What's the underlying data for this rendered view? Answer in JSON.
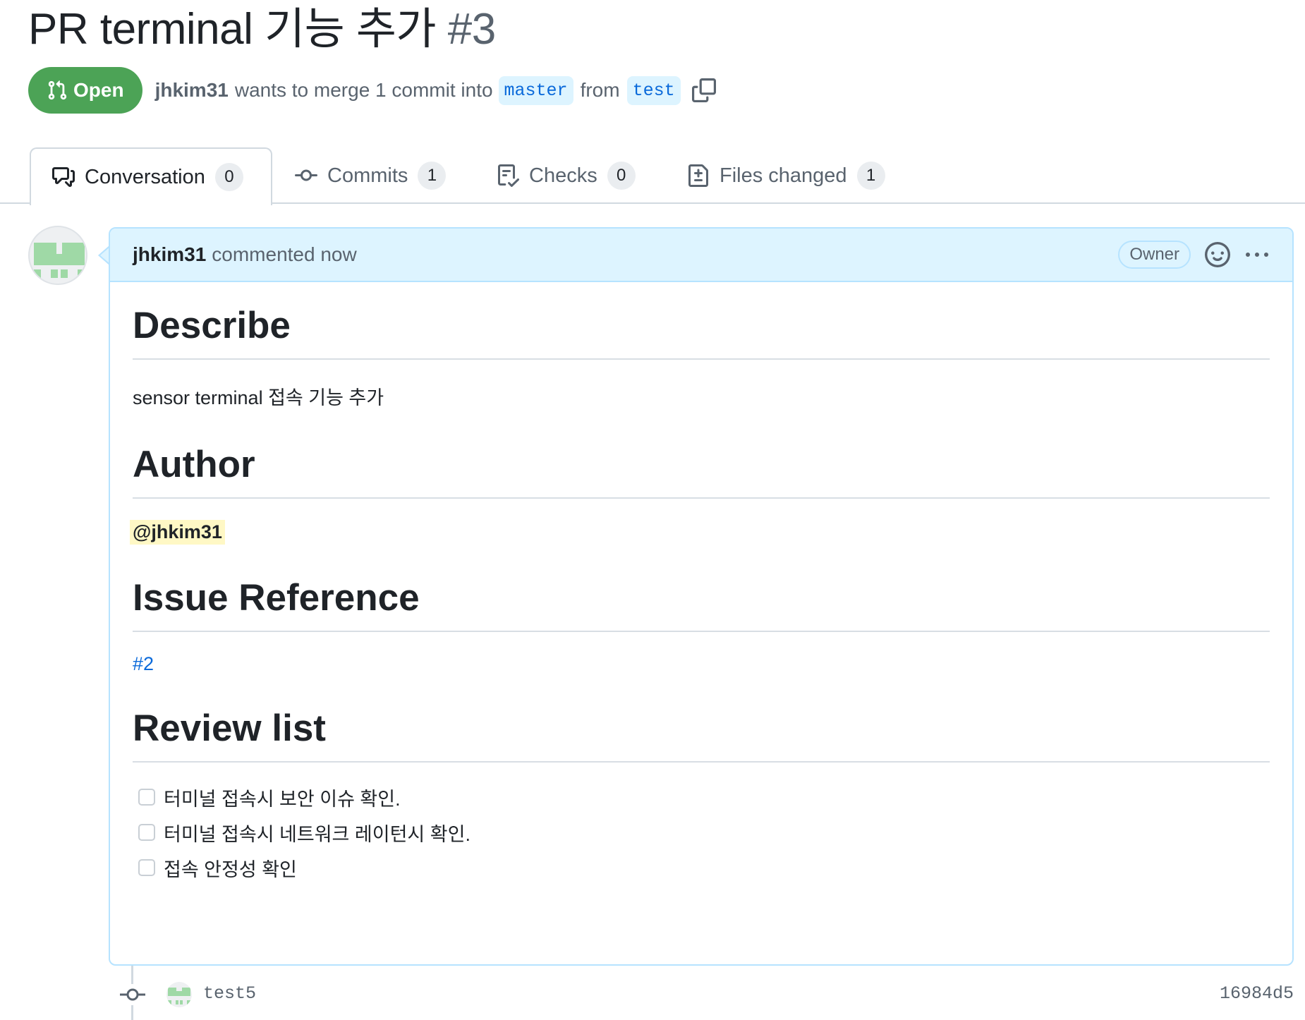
{
  "pr": {
    "title": "PR terminal 기능 추가",
    "number": "#3",
    "state": "Open",
    "author": "jhkim31",
    "merge_text": "wants to merge 1 commit into",
    "base_branch": "master",
    "from_text": "from",
    "head_branch": "test"
  },
  "tabs": [
    {
      "label": "Conversation",
      "count": "0",
      "icon": "comment-discussion-icon"
    },
    {
      "label": "Commits",
      "count": "1",
      "icon": "git-commit-icon"
    },
    {
      "label": "Checks",
      "count": "0",
      "icon": "checklist-icon"
    },
    {
      "label": "Files changed",
      "count": "1",
      "icon": "file-diff-icon"
    }
  ],
  "comment": {
    "author": "jhkim31",
    "action": "commented now",
    "badge": "Owner",
    "sections": {
      "describe_title": "Describe",
      "describe_text": "sensor terminal 접속 기능 추가",
      "author_title": "Author",
      "author_mention": "@jhkim31",
      "issue_title": "Issue Reference",
      "issue_link": "#2",
      "review_title": "Review list"
    },
    "review_items": [
      "터미널 접속시 보안 이슈 확인.",
      "터미널 접속시 네트워크 레이턴시 확인.",
      "접속 안정성 확인"
    ]
  },
  "commit": {
    "message": "test5",
    "sha": "16984d5"
  },
  "colors": {
    "open_green": "#4ca356",
    "link_blue": "#0969da",
    "header_bg": "#ddf4ff",
    "mention_bg": "#fff8c5"
  }
}
